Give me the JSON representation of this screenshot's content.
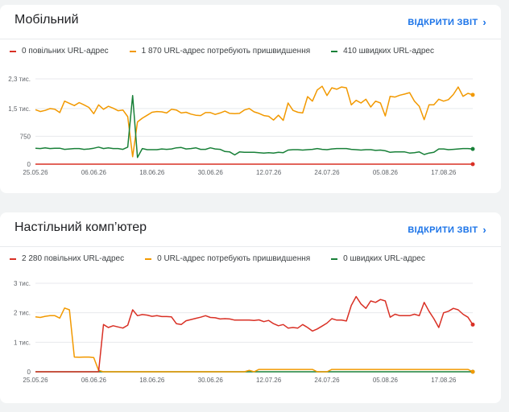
{
  "colors": {
    "slow": "#d93025",
    "improve": "#f29900",
    "fast": "#188038",
    "accent": "#1a73e8"
  },
  "open_report_label": "ВІДКРИТИ ЗВІТ",
  "chevron_icon": "chevron-right-icon",
  "chart_data": [
    {
      "type": "line",
      "title": "Мобільний",
      "ylim": [
        0,
        2300
      ],
      "yticks": [
        0,
        750,
        1500,
        2300
      ],
      "ytick_labels": [
        "0",
        "750",
        "1,5 тис.",
        "2,3 тис."
      ],
      "x": [
        "25.05.26",
        "06.06.26",
        "18.06.26",
        "30.06.26",
        "12.07.26",
        "24.07.26",
        "05.08.26",
        "17.08.26"
      ],
      "grid": true,
      "legend_placement": "top",
      "series": [
        {
          "name": "0 повільних URL-адрес",
          "color_key": "slow",
          "values": [
            0,
            0,
            0,
            0,
            0,
            0,
            0,
            0,
            0,
            0,
            0,
            0,
            0,
            0,
            0,
            0,
            0,
            0,
            0,
            0,
            0,
            0,
            0,
            0,
            0,
            0,
            0,
            0,
            0,
            0,
            0,
            0,
            0,
            0,
            0,
            0,
            0,
            0,
            0,
            0,
            0,
            0,
            0,
            0,
            0,
            0,
            0,
            0,
            0,
            0,
            0,
            0,
            0,
            0,
            0,
            0,
            0,
            0,
            0,
            0,
            0,
            0,
            0,
            0,
            0,
            0,
            0,
            0,
            0,
            0,
            0,
            0,
            0,
            0,
            0,
            0,
            0,
            0,
            0,
            0,
            0,
            0,
            0,
            0,
            0,
            0,
            0,
            0,
            0,
            0,
            0
          ]
        },
        {
          "name": "1 870 URL-адрес потребують пришвидшення",
          "color_key": "improve",
          "values": [
            1470,
            1420,
            1450,
            1500,
            1480,
            1390,
            1700,
            1640,
            1580,
            1660,
            1600,
            1530,
            1360,
            1600,
            1480,
            1560,
            1510,
            1440,
            1460,
            1280,
            200,
            1140,
            1240,
            1320,
            1400,
            1420,
            1410,
            1380,
            1480,
            1460,
            1380,
            1400,
            1350,
            1320,
            1310,
            1390,
            1390,
            1340,
            1380,
            1430,
            1370,
            1360,
            1370,
            1460,
            1500,
            1410,
            1370,
            1310,
            1290,
            1190,
            1320,
            1180,
            1650,
            1450,
            1400,
            1380,
            1820,
            1700,
            2000,
            2100,
            1850,
            2060,
            2020,
            2080,
            2060,
            1600,
            1720,
            1650,
            1750,
            1540,
            1700,
            1650,
            1300,
            1830,
            1810,
            1860,
            1890,
            1930,
            1700,
            1560,
            1200,
            1600,
            1600,
            1750,
            1700,
            1740,
            1880,
            2080,
            1830,
            1910,
            1870
          ]
        },
        {
          "name": "410 швидких URL-адрес",
          "color_key": "fast",
          "values": [
            430,
            420,
            440,
            420,
            430,
            430,
            400,
            410,
            420,
            420,
            400,
            410,
            430,
            460,
            420,
            440,
            420,
            420,
            400,
            460,
            1850,
            180,
            420,
            390,
            390,
            390,
            410,
            400,
            410,
            440,
            450,
            410,
            420,
            440,
            400,
            400,
            440,
            410,
            400,
            340,
            330,
            250,
            330,
            320,
            320,
            320,
            310,
            300,
            310,
            300,
            320,
            310,
            380,
            390,
            390,
            380,
            390,
            400,
            420,
            400,
            390,
            410,
            420,
            420,
            420,
            400,
            390,
            380,
            390,
            390,
            370,
            380,
            360,
            320,
            330,
            330,
            330,
            300,
            310,
            330,
            260,
            300,
            320,
            410,
            410,
            390,
            400,
            410,
            420,
            420,
            410
          ]
        }
      ]
    },
    {
      "type": "line",
      "title": "Настільний комп’ютер",
      "ylim": [
        0,
        3000
      ],
      "yticks": [
        0,
        1000,
        2000,
        3000
      ],
      "ytick_labels": [
        "0",
        "1 тис.",
        "2 тис.",
        "3 тис."
      ],
      "x": [
        "25.05.26",
        "06.06.26",
        "18.06.26",
        "30.06.26",
        "12.07.26",
        "24.07.26",
        "05.08.26",
        "17.08.26"
      ],
      "grid": true,
      "legend_placement": "top",
      "series": [
        {
          "name": "2 280 повільних URL-адрес",
          "color_key": "slow",
          "values": [
            0,
            0,
            0,
            0,
            0,
            0,
            0,
            0,
            0,
            0,
            0,
            0,
            0,
            0,
            1600,
            1500,
            1560,
            1520,
            1480,
            1580,
            2100,
            1900,
            1940,
            1920,
            1880,
            1900,
            1870,
            1870,
            1860,
            1630,
            1600,
            1730,
            1770,
            1810,
            1850,
            1900,
            1840,
            1830,
            1790,
            1800,
            1790,
            1750,
            1750,
            1750,
            1750,
            1740,
            1760,
            1700,
            1740,
            1630,
            1560,
            1600,
            1480,
            1500,
            1480,
            1600,
            1500,
            1380,
            1450,
            1550,
            1650,
            1800,
            1750,
            1750,
            1720,
            2250,
            2550,
            2300,
            2150,
            2400,
            2350,
            2450,
            2400,
            1850,
            1950,
            1900,
            1900,
            1900,
            1950,
            1900,
            2350,
            2050,
            1800,
            1500,
            2000,
            2050,
            2150,
            2100,
            1950,
            1850,
            1600
          ]
        },
        {
          "name": "0 URL-адрес потребують пришвидшення",
          "color_key": "improve",
          "values": [
            1860,
            1840,
            1880,
            1900,
            1900,
            1820,
            2160,
            2100,
            500,
            490,
            500,
            500,
            480,
            50,
            0,
            0,
            0,
            0,
            0,
            0,
            0,
            0,
            0,
            0,
            0,
            0,
            0,
            0,
            0,
            0,
            0,
            0,
            0,
            0,
            0,
            0,
            0,
            0,
            0,
            0,
            0,
            0,
            0,
            0,
            50,
            0,
            80,
            80,
            80,
            80,
            80,
            80,
            80,
            80,
            80,
            80,
            80,
            80,
            0,
            0,
            0,
            80,
            80,
            80,
            80,
            80,
            80,
            80,
            80,
            80,
            80,
            80,
            80,
            80,
            80,
            80,
            80,
            80,
            80,
            80,
            80,
            80,
            80,
            80,
            80,
            80,
            80,
            80,
            80,
            80,
            0
          ]
        },
        {
          "name": "0 швидких URL-адрес",
          "color_key": "fast",
          "values": [
            0,
            0,
            0,
            0,
            0,
            0,
            0,
            0,
            0,
            0,
            0,
            0,
            0,
            0,
            0,
            0,
            0,
            0,
            0,
            0,
            0,
            0,
            0,
            0,
            0,
            0,
            0,
            0,
            0,
            0,
            0,
            0,
            0,
            0,
            0,
            0,
            0,
            0,
            0,
            0,
            0,
            0,
            0,
            0,
            0,
            0,
            0,
            0,
            0,
            0,
            0,
            0,
            0,
            0,
            0,
            0,
            0,
            0,
            0,
            0,
            0,
            0,
            0,
            0,
            0,
            0,
            0,
            0,
            0,
            0,
            0,
            0,
            0,
            0,
            0,
            0,
            0,
            0,
            0,
            0,
            0,
            0,
            0,
            0,
            0,
            0,
            0,
            0,
            0,
            0,
            0
          ]
        }
      ]
    }
  ]
}
